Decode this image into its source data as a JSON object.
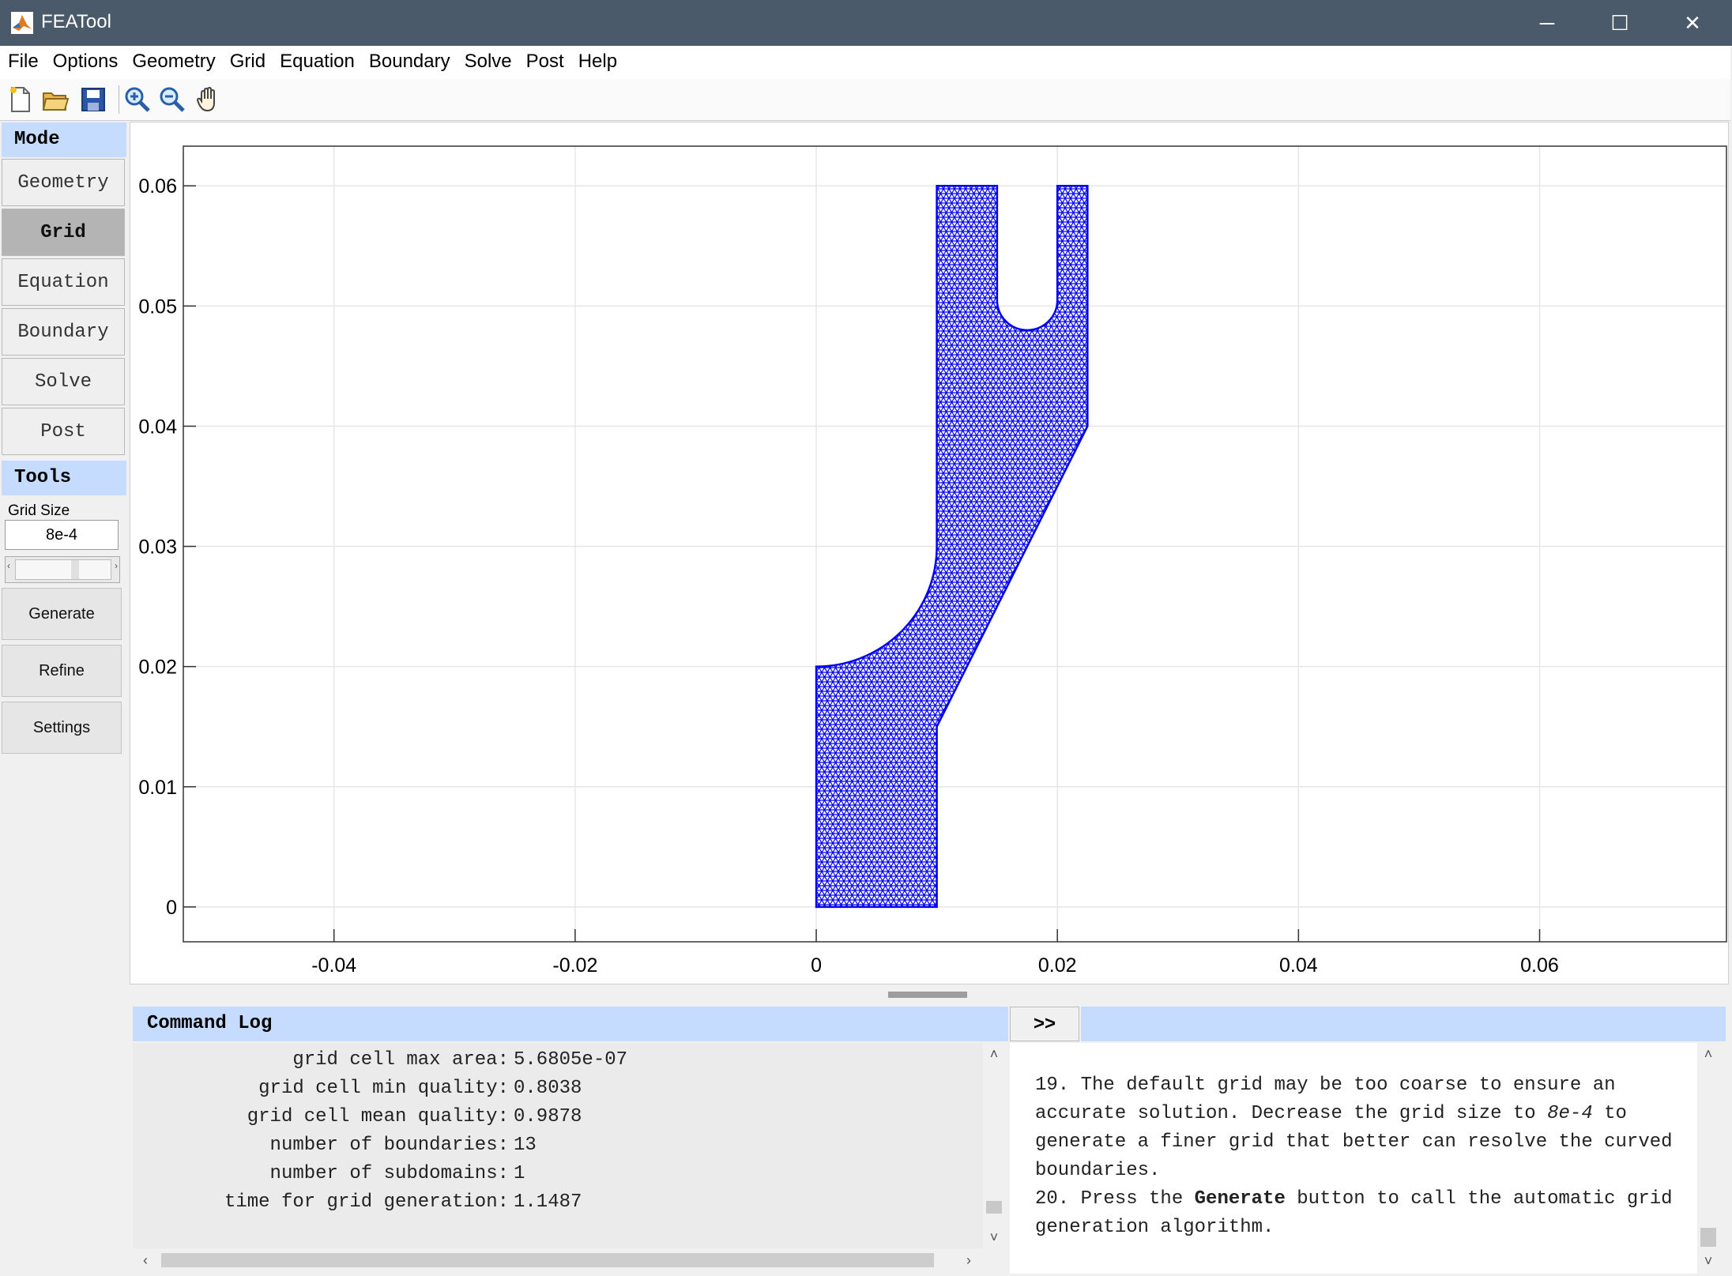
{
  "window": {
    "title": "FEATool",
    "minimize": "─",
    "maximize": "☐",
    "close": "✕"
  },
  "menu": [
    "File",
    "Options",
    "Geometry",
    "Grid",
    "Equation",
    "Boundary",
    "Solve",
    "Post",
    "Help"
  ],
  "toolbar": [
    "new-file-icon",
    "open-folder-icon",
    "save-icon",
    "zoom-in-icon",
    "zoom-out-icon",
    "pan-hand-icon"
  ],
  "sidebar": {
    "mode_header": "Mode",
    "modes": [
      "Geometry",
      "Grid",
      "Equation",
      "Boundary",
      "Solve",
      "Post"
    ],
    "active_mode": "Grid",
    "tools_header": "Tools",
    "grid_size_label": "Grid Size",
    "grid_size_value": "8e-4",
    "buttons": [
      "Generate",
      "Refine",
      "Settings"
    ]
  },
  "plot": {
    "x_ticks": [
      "-0.04",
      "-0.02",
      "0",
      "0.02",
      "0.04",
      "0.06"
    ],
    "y_ticks": [
      "0",
      "0.01",
      "0.02",
      "0.03",
      "0.04",
      "0.05",
      "0.06"
    ],
    "xlim": [
      -0.0525,
      0.0755
    ],
    "ylim": [
      -0.0029,
      0.0633
    ],
    "mesh_color": "#0000ee",
    "mesh_type": "triangular grid",
    "geometry_outline": [
      [
        0,
        0
      ],
      [
        0.01,
        0
      ],
      [
        0.01,
        0.015
      ],
      [
        0.0225,
        0.04
      ],
      [
        0.0225,
        0.06
      ],
      [
        0.02,
        0.06
      ],
      [
        0.02,
        0.05
      ],
      [
        0.015,
        0.05
      ],
      [
        0.015,
        0.06
      ],
      [
        0.01,
        0.06
      ],
      [
        0.01,
        0.03
      ],
      [
        0,
        0.02
      ]
    ]
  },
  "command_log": {
    "title": "Command Log",
    "lines": [
      {
        "label": "grid cell max area:",
        "value": "5.6805e-07"
      },
      {
        "label": "grid cell min quality:",
        "value": "0.8038"
      },
      {
        "label": "grid cell mean quality:",
        "value": "0.9878"
      },
      {
        "label": "number of boundaries:",
        "value": "13"
      },
      {
        "label": "number of subdomains:",
        "value": "1"
      },
      {
        "label": "time for grid generation:",
        "value": "1.1487"
      }
    ]
  },
  "expand_button": ">>",
  "info": {
    "step19": {
      "part1": "19. The default grid may be too coarse to ensure an accurate solution. Decrease the grid size to ",
      "emph": "8e-4",
      "part2": " to generate a finer grid that better can resolve the curved boundaries."
    },
    "step20": {
      "part1": "20. Press the ",
      "bold": "Generate",
      "part2": " button to call the automatic grid generation algorithm."
    }
  }
}
